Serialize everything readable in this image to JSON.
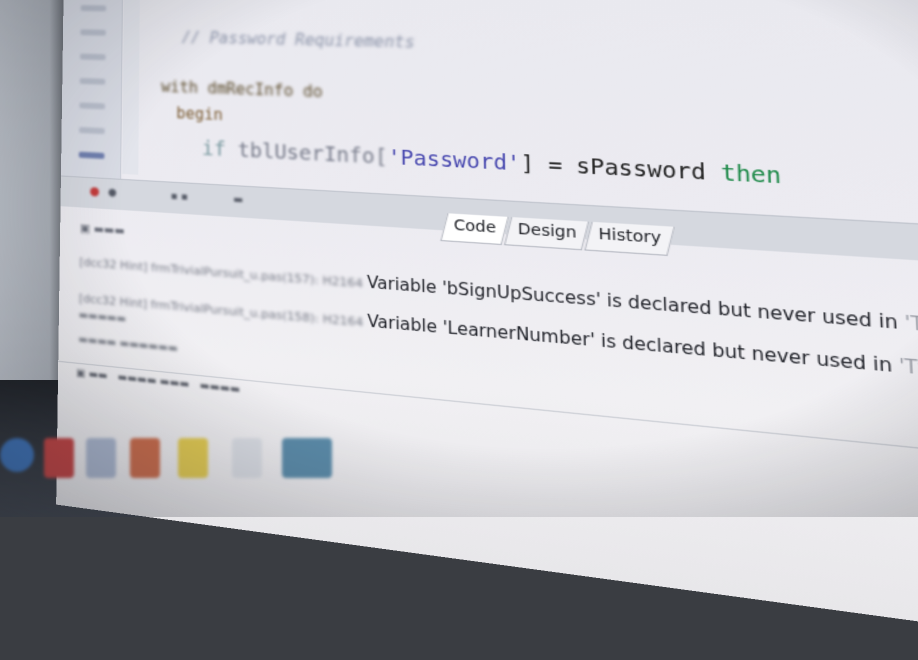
{
  "editor": {
    "comment_line": "// Password Requirements",
    "with_line": "with dmRecInfo do",
    "begin_line": "begin",
    "if_line": {
      "kw_if": "if",
      "ident": "tblUserInfo[",
      "string": "'Password'",
      "close": "]",
      "op": " = ",
      "var": "sPassword ",
      "kw_then": "then"
    }
  },
  "tabs": [
    {
      "label": "Code"
    },
    {
      "label": "Design"
    },
    {
      "label": "History"
    }
  ],
  "messages": {
    "rows": [
      {
        "prefix": "[dcc32 Hint] frmTrivialPursuit_u.pas(157): H2164 ",
        "text": "Variable 'bSignUpSuccess' is declared but never used in ",
        "suffix": "'TfrmTrivialP"
      },
      {
        "prefix": "[dcc32 Hint] frmTrivialPursuit_u.pas(158): H2164 ",
        "text": "Variable 'LearnerNumber' is declared but never used in ",
        "suffix": "'TfrmTrivialPu"
      }
    ]
  },
  "colors": {
    "keyword_then": "#1f8a4a",
    "string": "#4a4ab0",
    "error_dot": "#c23a3a"
  }
}
